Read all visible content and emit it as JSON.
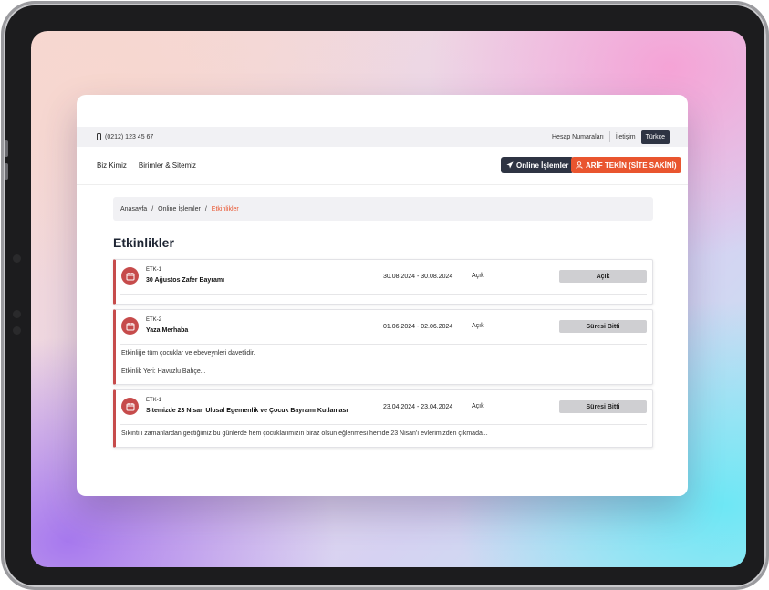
{
  "topbar": {
    "phone": "(0212) 123 45 67",
    "account_numbers": "Hesap Numaraları",
    "contact": "İletişim",
    "language": "Türkçe"
  },
  "nav": {
    "links": [
      "Biz Kimiz",
      "Birimler & Sitemiz"
    ],
    "online_button": "Online İşlemler",
    "user_button": "ARİF TEKİN (SİTE SAKİNİ)"
  },
  "breadcrumb": {
    "home": "Anasayfa",
    "separator": "/",
    "middle": "Online İşlemler",
    "current": "Etkinlikler"
  },
  "page_title": "Etkinlikler",
  "events": [
    {
      "code": "ETK-1",
      "title": "30 Ağustos Zafer Bayramı",
      "dates": "30.08.2024 - 30.08.2024",
      "status_text": "Açık",
      "status_button": "Açık",
      "description": []
    },
    {
      "code": "ETK-2",
      "title": "Yaza Merhaba",
      "dates": "01.06.2024 - 02.06.2024",
      "status_text": "Açık",
      "status_button": "Süresi Bitti",
      "description": [
        "Etkinliğe tüm çocuklar ve ebeveynleri davetlidir.",
        "Etkinlik Yeri: Havuzlu Bahçe..."
      ]
    },
    {
      "code": "ETK-1",
      "title": "Sitemizde 23 Nisan Ulusal Egemenlik ve Çocuk Bayramı Kutlaması",
      "dates": "23.04.2024 - 23.04.2024",
      "status_text": "Açık",
      "status_button": "Süresi Bitti",
      "description": [
        "Sıkıntılı zamanlardan geçtiğimiz bu günlerde hem çocuklarımızın biraz olsun eğlenmesi hemde 23 Nisan'ı evlerimizden çıkmada..."
      ]
    }
  ],
  "colors": {
    "accent": "#e9552f",
    "dark": "#2e3443",
    "event_red": "#c64b4b"
  }
}
